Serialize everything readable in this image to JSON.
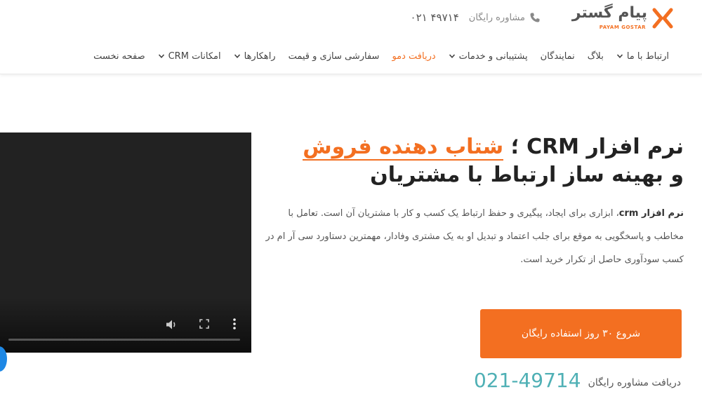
{
  "header": {
    "logo": {
      "brand_fa": "پیام گستر",
      "brand_en": "PAYAM GOSTAR",
      "icon": "payam-gostar-logo-icon",
      "color": "#f36f21"
    },
    "consult": {
      "label": "مشاوره رایگان",
      "number": "۴۹۷۱۴ ۰۲۱",
      "icon": "phone-icon"
    }
  },
  "nav": {
    "items": [
      {
        "label": "صفحه نخست",
        "has_dropdown": false
      },
      {
        "label": "امکانات CRM",
        "has_dropdown": true
      },
      {
        "label": "راهکارها",
        "has_dropdown": true
      },
      {
        "label": "سفارشی سازی و قیمت",
        "has_dropdown": false
      },
      {
        "label": "دریافت دمو",
        "has_dropdown": false,
        "active": true
      },
      {
        "label": "پشتیبانی و خدمات",
        "has_dropdown": true
      },
      {
        "label": "نمایندگان",
        "has_dropdown": false
      },
      {
        "label": "بلاگ",
        "has_dropdown": false
      },
      {
        "label": "ارتباط با ما",
        "has_dropdown": true
      }
    ]
  },
  "hero": {
    "title_prefix": "نرم افزار CRM ؛ ",
    "title_accent": "شتاب دهنده فروش",
    "title_line2": "و بهینه ساز ارتباط با مشتریان",
    "para_bold": "نرم افزار crm",
    "para_text": "، ابزاری برای ایجاد، پیگیری و حفظ ارتباط یک کسب و کار با مشتریان آن است. تعامل با مخاطب و پاسخگویی به موقع برای جلب اعتماد و تبدیل او به یک مشتری وفادار، مهمترین دستاورد سی آر ام در کسب سودآوری حاصل از تکرار خرید است.",
    "cta_label": "شروع ۳۰ روز استفاده رایگان",
    "bottom_label": "دریافت مشاوره رایگان",
    "bottom_number": "021-49714"
  },
  "video": {
    "progress": 0,
    "icons": [
      "volume-icon",
      "fullscreen-icon",
      "more-options-icon"
    ]
  },
  "colors": {
    "accent": "#f36f21",
    "number": "#4fb0b5",
    "text": "#333333",
    "float_button": "#1e88e5"
  }
}
